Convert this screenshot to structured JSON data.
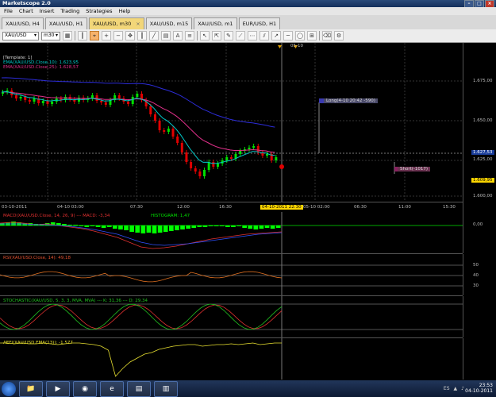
{
  "app_title": "Marketscope 2.0",
  "menu": [
    "File",
    "Chart",
    "Insert",
    "Trading",
    "Strategies",
    "Help"
  ],
  "tabs": [
    {
      "label": "XAU/USD, H4",
      "active": false
    },
    {
      "label": "XAU/USD, H1",
      "active": false
    },
    {
      "label": "XAU/USD, m30",
      "active": true
    },
    {
      "label": "XAU/USD, m15",
      "active": false
    },
    {
      "label": "XAU/USD, m1",
      "active": false
    },
    {
      "label": "EUR/USD, H1",
      "active": false
    }
  ],
  "toolbar": {
    "symbol": "XAU/USD",
    "timeframe": "m30"
  },
  "main_chart": {
    "template": "[Template: 1]",
    "ema10": "EMA(XAU/USD.Close,10): 1.623,95",
    "ema25": "EMA(XAU/USD.Close,25): 1.628,57",
    "price_labels": [
      "1.675,00",
      "1.650,00",
      "1.627,53",
      "1.625,00",
      "1.609,95",
      "1.600,00"
    ],
    "badge_long": "Long(4-10 20:42 -590)",
    "badge_short": "Short(-1017)",
    "top_marker": "05-10",
    "colors": {
      "ema10": "#00c8c8",
      "ema25": "#e0308a",
      "up": "#00e000",
      "down": "#e00000",
      "ema_blue": "#2c2cd8"
    }
  },
  "time_axis": [
    "03-10-2011",
    "04-10 03:00",
    "07:30",
    "12:00",
    "16:30",
    "04-10-2011 22:30",
    "05-10 02:00",
    "06:30",
    "11:00",
    "15:30"
  ],
  "macd": {
    "label": "MACD(XAU/USD.Close, 14, 26, 9) --- MACD: -3,34",
    "histogram": "HISTOGRAM: 1,47",
    "axis": "0,00"
  },
  "rsi": {
    "label": "RSI(XAU/USD.Close, 14): 49,18",
    "axis": [
      "50",
      "40",
      "30"
    ]
  },
  "stoch": {
    "label": "STOCHASTIC(XAU/USD, 5, 3, 3, MVA, MVA) --- K: 31,36 --- D: 29,34"
  },
  "aefi": {
    "label": "AEFI(XAU/USD.EMA(13)): -1.577"
  },
  "taskbar": {
    "lang": "ES",
    "time": "23:53",
    "date": "04-10-2011"
  }
}
